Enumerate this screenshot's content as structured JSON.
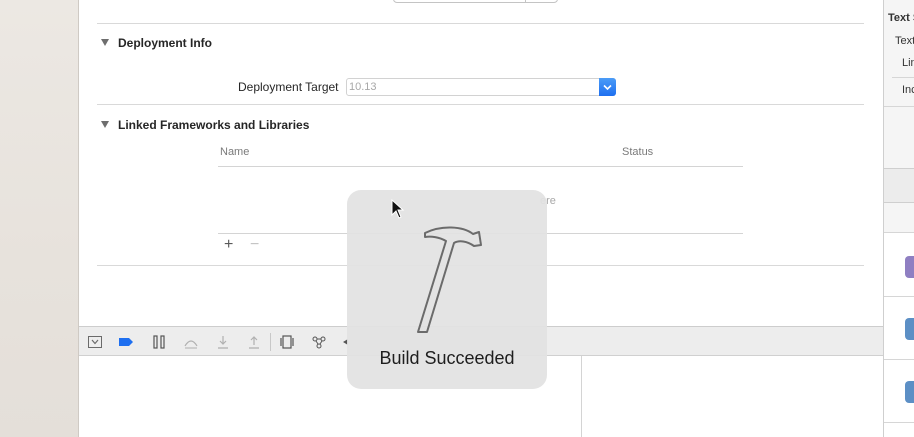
{
  "deployment": {
    "section_title": "Deployment Info",
    "target_label": "Deployment Target",
    "target_value": "10.13"
  },
  "frameworks": {
    "section_title": "Linked Frameworks and Libraries",
    "col_name": "Name",
    "col_status": "Status",
    "placeholder_fragment": "ere",
    "add_label": "+",
    "remove_label": "−"
  },
  "hud": {
    "message": "Build Succeeded",
    "icon": "hammer-icon"
  },
  "debug_bar": {
    "icons": [
      "hide-debug-area-icon",
      "breakpoints-toggle-icon",
      "pause-icon",
      "step-over-icon",
      "step-in-icon",
      "step-out-icon",
      "view-debugger-icon",
      "memory-graph-icon",
      "location-icon"
    ]
  },
  "inspector": {
    "text_settings": "Text S",
    "text": "Text",
    "lin": "Lin",
    "inc": "Inc"
  },
  "colors": {
    "accent": "#1e6ff0",
    "hud_bg": "#e2e2e2",
    "library_icon_purple": "#8f7fc2",
    "library_icon_blue": "#5c8fc5"
  }
}
